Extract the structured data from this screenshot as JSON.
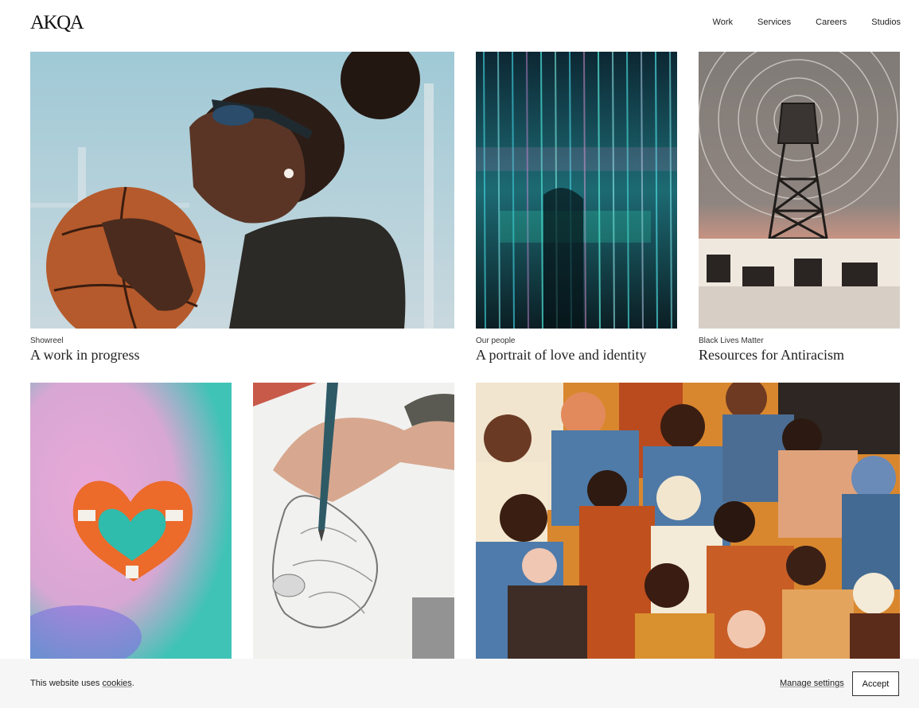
{
  "header": {
    "logo": "AKQA",
    "nav": [
      "Work",
      "Services",
      "Careers",
      "Studios"
    ]
  },
  "cards": [
    {
      "eyebrow": "Showreel",
      "title": "A work in progress",
      "image": "woman-with-basketball"
    },
    {
      "eyebrow": "Our people",
      "title": "A portrait of love and identity",
      "image": "light-curtain-installation"
    },
    {
      "eyebrow": "Black Lives Matter",
      "title": "Resources for Antiracism",
      "image": "radio-tower-fist-illustration"
    },
    {
      "eyebrow": "",
      "title": "",
      "image": "lifebuoy-heart"
    },
    {
      "eyebrow": "",
      "title": "",
      "image": "hand-sketching"
    },
    {
      "eyebrow": "",
      "title": "",
      "image": "crowd-illustration"
    }
  ],
  "cookie": {
    "text_prefix": "This website uses",
    "link": "cookies",
    "text_suffix": ".",
    "manage": "Manage settings",
    "accept": "Accept"
  }
}
